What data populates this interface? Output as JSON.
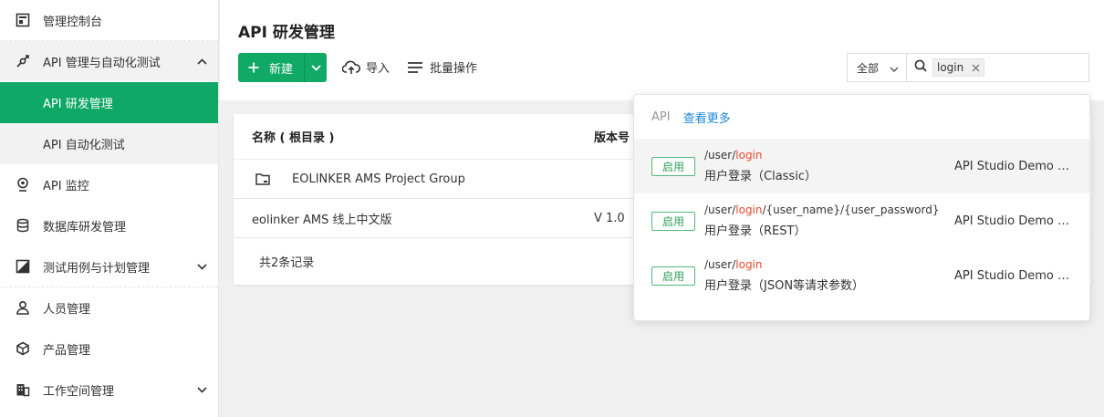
{
  "sidebar": {
    "items": [
      {
        "label": "管理控制台",
        "icon": "dashboard-icon"
      },
      {
        "label": "API 管理与自动化测试",
        "icon": "api-manage-icon",
        "expanded": true,
        "children": [
          {
            "label": "API 研发管理",
            "active": true
          },
          {
            "label": "API 自动化测试"
          }
        ]
      },
      {
        "label": "API 监控",
        "icon": "monitor-icon"
      },
      {
        "label": "数据库研发管理",
        "icon": "database-icon"
      },
      {
        "label": "测试用例与计划管理",
        "icon": "testcase-icon"
      },
      {
        "label": "人员管理",
        "icon": "people-icon"
      },
      {
        "label": "产品管理",
        "icon": "product-icon"
      },
      {
        "label": "工作空间管理",
        "icon": "workspace-icon"
      }
    ]
  },
  "header": {
    "title": "API 研发管理",
    "new_label": "新建",
    "import_label": "导入",
    "batch_label": "批量操作"
  },
  "filter": {
    "scope_selected": "全部",
    "search_tag": "login"
  },
  "table": {
    "columns": [
      "名称 ( 根目录 )",
      "版本号"
    ],
    "rows": [
      {
        "name": "EOLINKER AMS Project Group",
        "version": "",
        "is_folder": true
      },
      {
        "name": "eolinker AMS 线上中文版",
        "version": "V 1.0",
        "is_folder": false
      }
    ],
    "footer": "共2条记录"
  },
  "dropdown": {
    "category": "API",
    "more_label": "查看更多",
    "results": [
      {
        "status": "启用",
        "path_prefix": "/user/",
        "path_keyword": "login",
        "path_suffix": "",
        "description": "用户登录（Classic）",
        "project": "API Studio Demo P..."
      },
      {
        "status": "启用",
        "path_prefix": "/user/",
        "path_keyword": "login",
        "path_suffix": "/{user_name}/{user_password}",
        "description": "用户登录（REST）",
        "project": "API Studio Demo P..."
      },
      {
        "status": "启用",
        "path_prefix": "/user/",
        "path_keyword": "login",
        "path_suffix": "",
        "description": "用户登录（JSON等请求参数）",
        "project": "API Studio Demo P..."
      }
    ]
  },
  "colors": {
    "accent": "#10a966",
    "link": "#1e88d8",
    "keyword": "#e24a2c"
  }
}
